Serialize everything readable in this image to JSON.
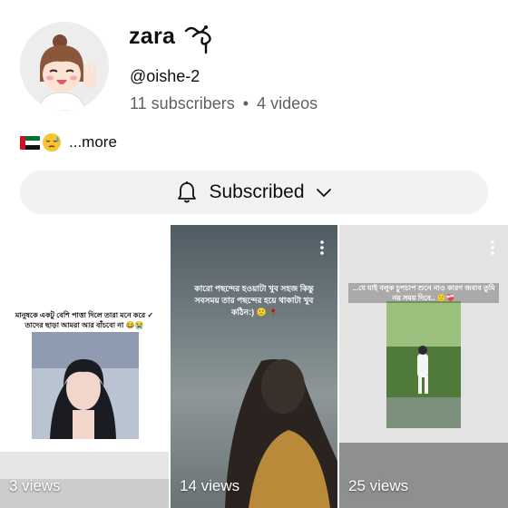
{
  "channel": {
    "name": "zara",
    "handle": "@oishe-2",
    "subscribers": "11 subscribers",
    "separator": "•",
    "videos": "4 videos",
    "description_more": "...more"
  },
  "subscribe_button": {
    "label": "Subscribed",
    "icon": "bell-icon",
    "chevron": "chevron-down-icon"
  },
  "videos": [
    {
      "views": "3 views",
      "caption": "মানুষকে একটু বেশি পাত্তা দিলে তারা মনে করে ✓ তাদের ছাড়া আমরা আর বাঁচবো না 😂😭"
    },
    {
      "views": "14 views",
      "caption": "কারো পছন্দের হওয়াটা খুব সহজ কিন্তু সবসময় তার পছন্দের হয়ে থাকাটা খুব কঠিন:) 🙂🥀"
    },
    {
      "views": "25 views",
      "caption": "...যে যাই বলুক চুপচাপ শুনে নাও কারণ জবাব তুমি নয় সময় দিবে.. 🙂❤️‍🩹"
    }
  ],
  "colors": {
    "accent": "#0f0f0f",
    "muted": "#606060",
    "button_bg": "#f2f2f2"
  }
}
